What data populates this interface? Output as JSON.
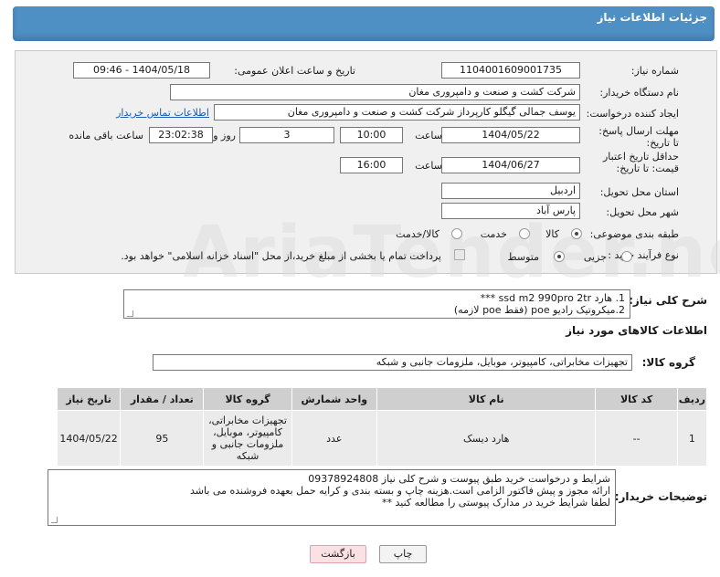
{
  "header": {
    "title": "جزئیات اطلاعات نیاز"
  },
  "form": {
    "need_number_label": "شماره نیاز:",
    "need_number": "1104001609001735",
    "announce_label": "تاریخ و ساعت اعلان عمومی:",
    "announce_value": "1404/05/18 - 09:46",
    "buyer_org_label": "نام دستگاه خریدار:",
    "buyer_org": "شرکت کشت و صنعت و دامپروری مغان",
    "requester_label": "ایجاد کننده درخواست:",
    "requester": "یوسف جمالی گیگلو کارپرداز شرکت کشت و صنعت و دامپروری مغان",
    "contact_link": "اطلاعات تماس خریدار",
    "deadline_label": "مهلت ارسال پاسخ: تا تاریخ:",
    "deadline_date": "1404/05/22",
    "time_label": "ساعت",
    "deadline_time": "10:00",
    "days_value": "3",
    "days_label": "روز و",
    "remaining_time": "23:02:38",
    "remaining_label": "ساعت باقی مانده",
    "validity_label": "حداقل تاریخ اعتبار قیمت: تا تاریخ:",
    "validity_date": "1404/06/27",
    "validity_time": "16:00",
    "province_label": "استان محل تحویل:",
    "province": "اردبیل",
    "city_label": "شهر محل تحویل:",
    "city": "پارس آباد",
    "category_label": "طبقه بندی موضوعی:",
    "category_options": [
      "کالا",
      "خدمت",
      "کالا/خدمت"
    ],
    "process_label": "نوع فرآیند خرید :",
    "process_options": [
      "جزیی",
      "متوسط"
    ],
    "payment_note": "پرداخت تمام یا بخشی از مبلغ خرید،از محل \"اسناد خزانه اسلامی\" خواهد بود."
  },
  "summary": {
    "label": "شرح کلی نیاز:",
    "line1": "1. هارد ssd m2 990pro 2tr ***",
    "line2": "2.میکروتیک رادیو poe (فقط poe لازمه)"
  },
  "goods": {
    "section_title": "اطلاعات کالاهای مورد نیاز",
    "group_label": "گروه کالا:",
    "group_value": "تجهیزات مخابراتی، کامپیوتر، موبایل، ملزومات جانبی و شبکه",
    "columns": [
      "ردیف",
      "کد کالا",
      "نام کالا",
      "واحد شمارش",
      "گروه کالا",
      "تعداد / مقدار",
      "تاریخ نیاز"
    ],
    "rows": [
      {
        "row": "1",
        "code": "--",
        "name": "هارد دیسک",
        "unit": "عدد",
        "group": "تجهیزات مخابراتی، کامپیوتر، موبایل، ملزومات جانبی و شبکه",
        "qty": "95",
        "date": "1404/05/22"
      }
    ]
  },
  "buyer_notes": {
    "label": "توضیحات خریدار:",
    "line1": "شرایط و درخواست خرید طبق پیوست و شرح کلی نیاز 09378924808",
    "line2": "ارائه مجوز و پیش فاکتور الزامی است.هزینه چاپ و بسته بندی و کرایه حمل بعهده فروشنده می باشد",
    "line3": "لطفا شرایط خرید در مدارک پیوستی را مطالعه کنید **"
  },
  "buttons": {
    "print": "چاپ",
    "back": "بازگشت"
  },
  "watermark": "AriaTender.net"
}
